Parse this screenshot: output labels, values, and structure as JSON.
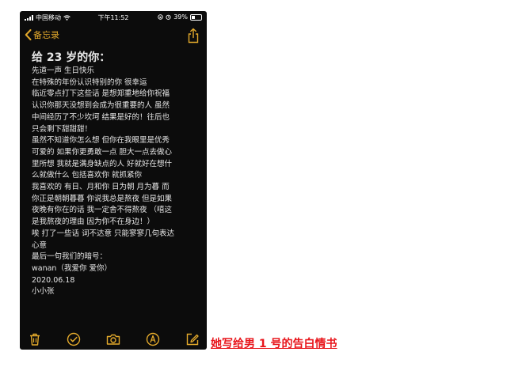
{
  "status_bar": {
    "carrier": "中国移动",
    "time": "下午11:52",
    "battery": "39%"
  },
  "nav": {
    "back_label": "备忘录"
  },
  "note": {
    "title": "给 23 岁的你：",
    "lines": [
      "先道一声 生日快乐",
      "在特殊的年份认识特别的你 很幸运",
      "临近零点打下这些话 是想郑重地给你祝福",
      "认识你那天没想到会成为很重要的人 虽然",
      "中间经历了不少坎坷 结果是好的！往后也",
      "只会剩下甜甜甜！",
      "虽然不知道你怎么想 但你在我眼里是优秀",
      "可爱的 如果你更勇敢一点 胆大一点去做心",
      "里所想 我就是满身缺点的人 好就好在想什",
      "么就做什么 包括喜欢你 就抓紧你",
      "我喜欢的 有日、月和你 日为朝 月为暮 而",
      "你正是朝朝暮暮 你说我总是熬夜 但是如果",
      "夜晚有你在的话 我一定舍不得熬夜 （嘻这",
      "是我熬夜的理由 因为你不在身边！）",
      "唉 打了一些话 词不达意 只能寥寥几句表达",
      "心意",
      "最后一句我们的暗号：",
      "wanan（我爱你 爱你）",
      "2020.06.18",
      "小小张"
    ]
  },
  "toolbar": {
    "icons": [
      "trash-icon",
      "checklist-icon",
      "camera-icon",
      "markup-icon",
      "compose-icon"
    ]
  },
  "caption": "她写给男 1 号的告白情书",
  "colors": {
    "accent": "#e3a92b",
    "background": "#0c0c0c",
    "caption": "#e8161c"
  }
}
